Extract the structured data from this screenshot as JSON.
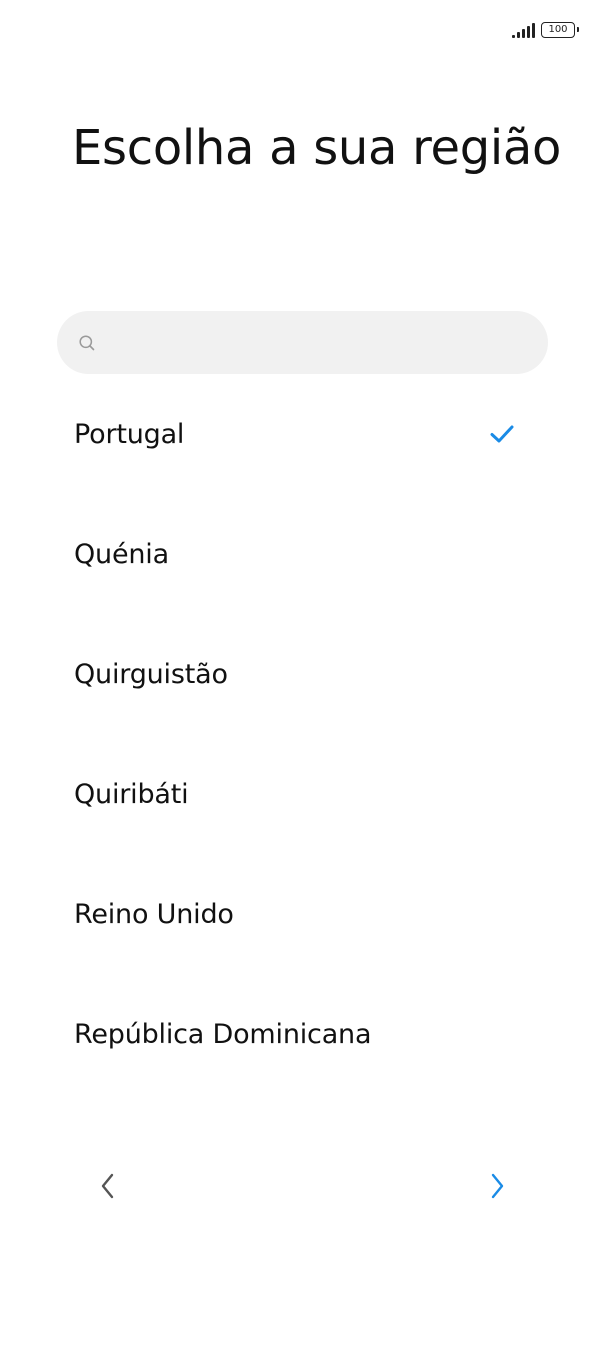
{
  "status_bar": {
    "signal_icon": "cellular-signal-icon",
    "battery_level": "100"
  },
  "page": {
    "title": "Escolha a sua região"
  },
  "search": {
    "icon": "search-icon",
    "value": "",
    "placeholder": ""
  },
  "regions": [
    {
      "label": "Portugal",
      "selected": true
    },
    {
      "label": "Quénia",
      "selected": false
    },
    {
      "label": "Quirguistão",
      "selected": false
    },
    {
      "label": "Quiribáti",
      "selected": false
    },
    {
      "label": "Reino Unido",
      "selected": false
    },
    {
      "label": "República Dominicana",
      "selected": false
    }
  ],
  "navigation": {
    "prev_icon": "chevron-left-icon",
    "next_icon": "chevron-right-icon"
  },
  "colors": {
    "accent": "#1a8be6",
    "text": "#111111",
    "search_bg": "#f1f1f1",
    "prev_arrow": "#555555"
  }
}
